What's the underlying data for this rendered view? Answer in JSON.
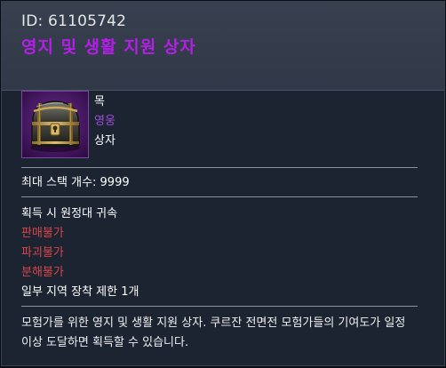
{
  "header": {
    "id_text": "ID: 61105742",
    "item_name": "영지 및 생활 지원 상자"
  },
  "item": {
    "icon": "treasure-chest-icon",
    "slot": "목",
    "rarity": "영웅",
    "type": "상자"
  },
  "stack": {
    "label": "최대 스택 개수: 9999"
  },
  "properties": {
    "bind": "획득 시 원정대 귀속",
    "no_sell": "판매불가",
    "no_destroy": "파괴불가",
    "no_disassemble": "분해불가",
    "equip_limit": "일부 지역 장착 제한 1개"
  },
  "description": "모험가를 위한 영지 및 생활 지원 상자. 쿠르잔 전면전 모험가들의 기여도가 일정 이상 도달하면 획득할 수 있습니다.",
  "colors": {
    "name": "#b31fe6",
    "rarity": "#a24ddc",
    "restriction": "#d9464b",
    "panel": "#1c2331",
    "header": "#353c4b"
  }
}
